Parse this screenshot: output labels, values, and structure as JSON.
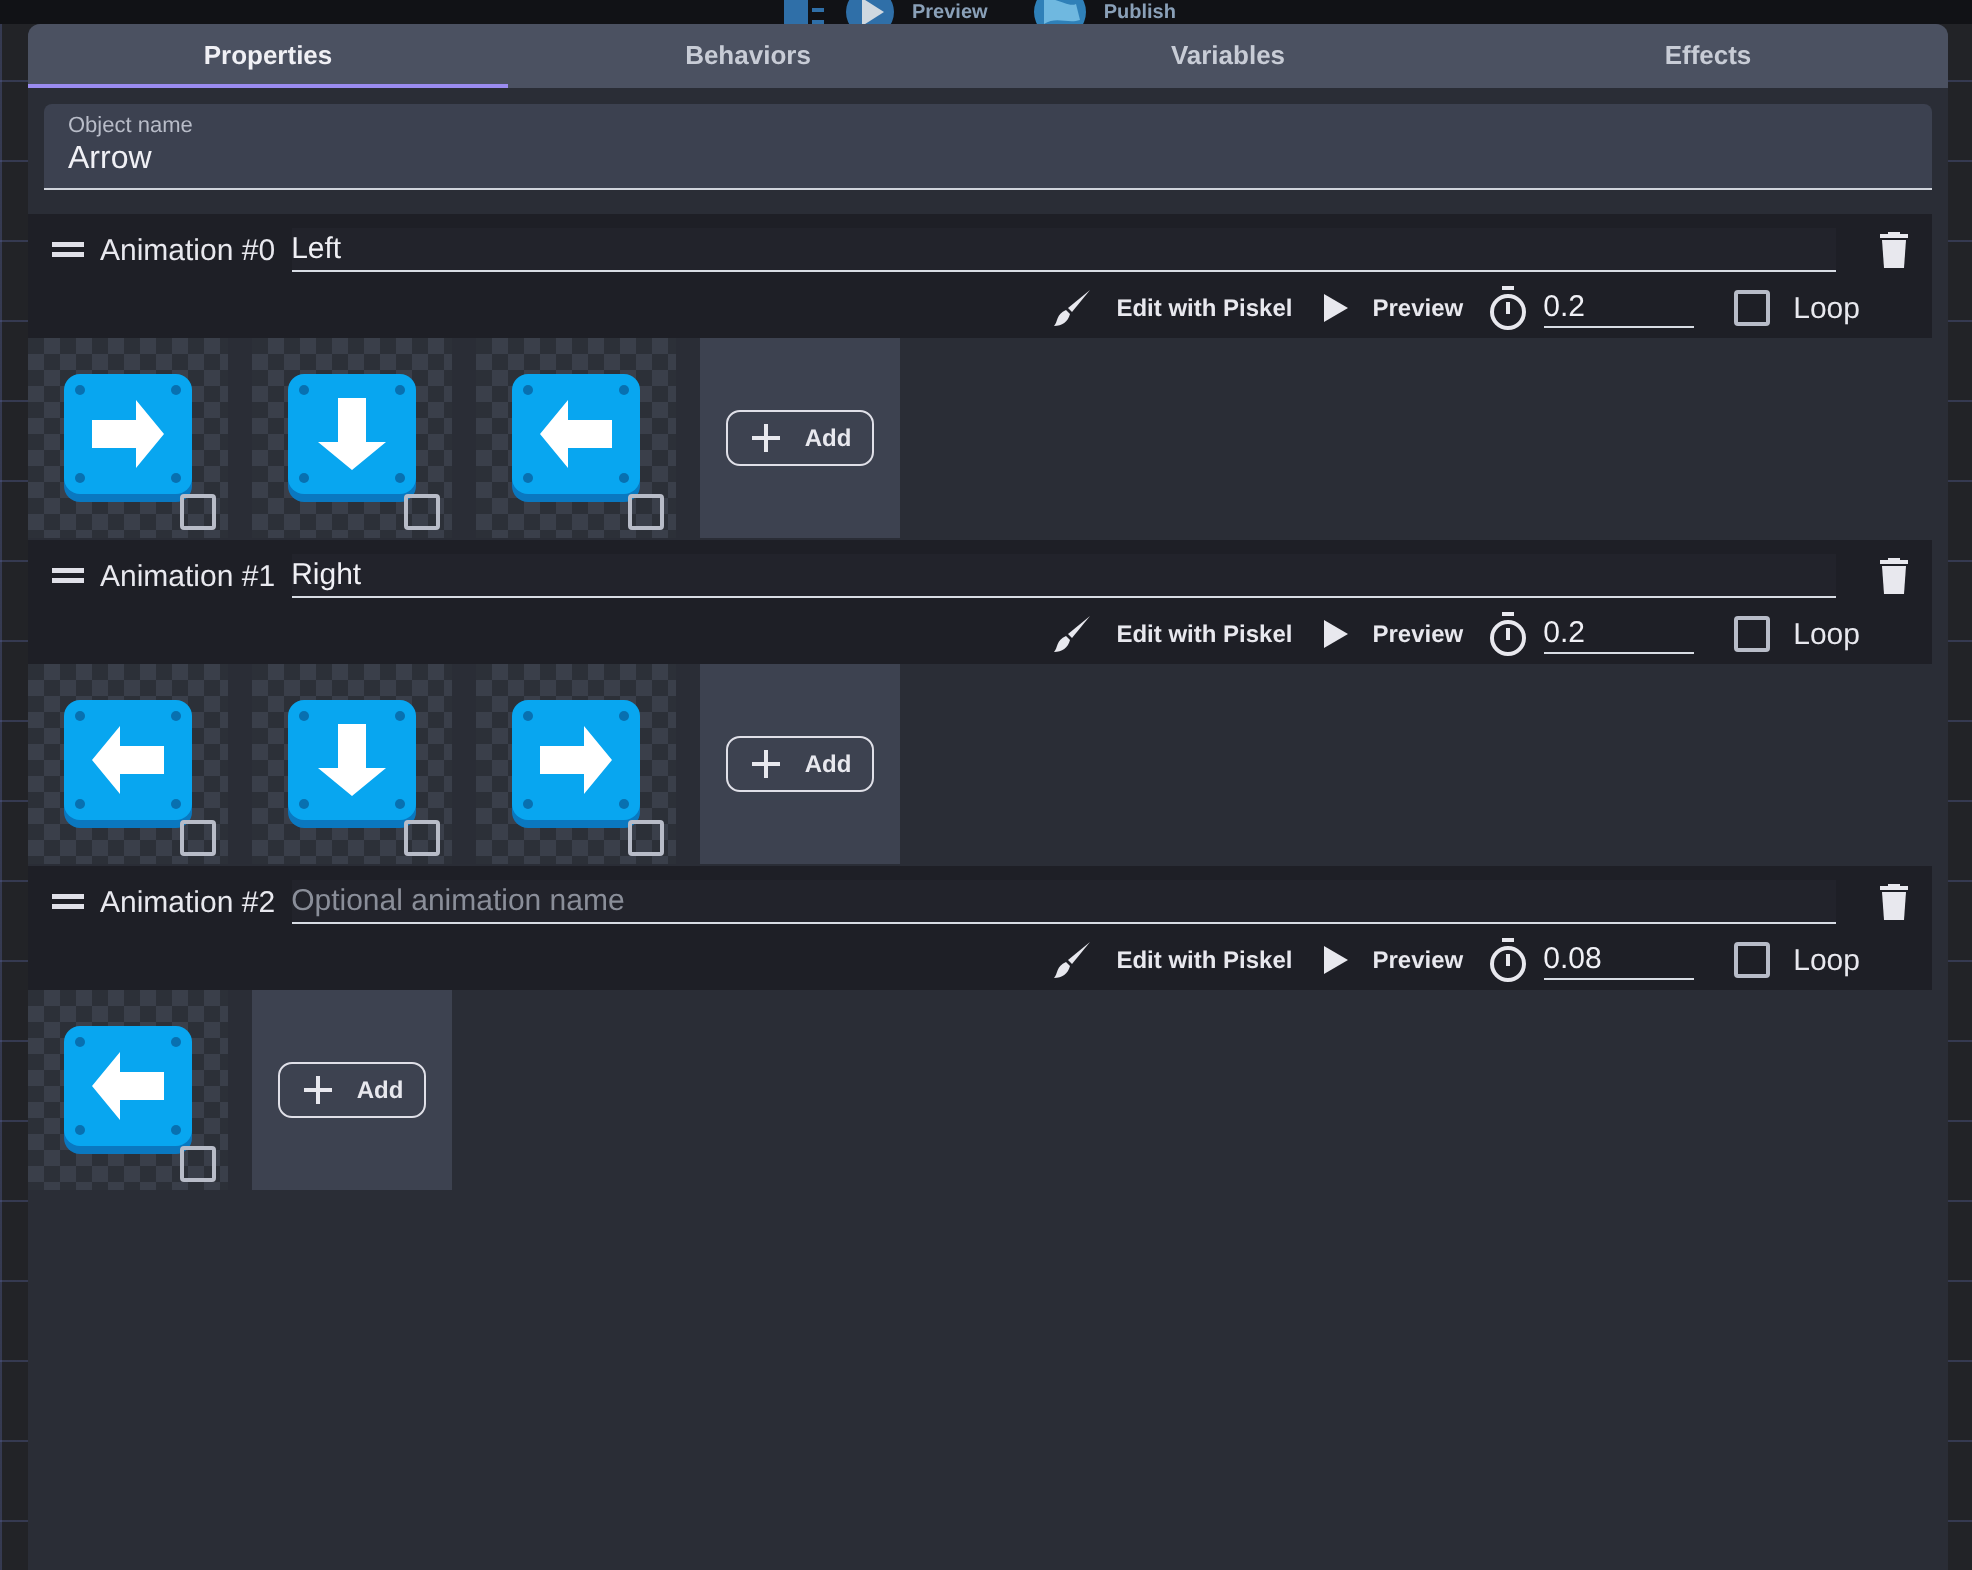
{
  "toolbar": {
    "items": [
      {
        "kind": "preview",
        "label": "Preview"
      },
      {
        "kind": "publish",
        "label": "Publish"
      }
    ]
  },
  "tabs": [
    {
      "label": "Properties",
      "selected": true
    },
    {
      "label": "Behaviors",
      "selected": false
    },
    {
      "label": "Variables",
      "selected": false
    },
    {
      "label": "Effects",
      "selected": false
    }
  ],
  "object_name": {
    "label": "Object name",
    "value": "Arrow"
  },
  "animations": [
    {
      "label": "Animation #0",
      "name": "Left",
      "edit_label": "Edit with Piskel",
      "preview_label": "Preview",
      "duration": "0.2",
      "loop": false,
      "loop_label": "Loop",
      "add_label": "Add",
      "frames": [
        {
          "kind": "right",
          "selected": false
        },
        {
          "kind": "down",
          "selected": false
        },
        {
          "kind": "left",
          "selected": false
        }
      ]
    },
    {
      "label": "Animation #1",
      "name": "Right",
      "edit_label": "Edit with Piskel",
      "preview_label": "Preview",
      "duration": "0.2",
      "loop": false,
      "loop_label": "Loop",
      "add_label": "Add",
      "frames": [
        {
          "kind": "left",
          "selected": false
        },
        {
          "kind": "down",
          "selected": false
        },
        {
          "kind": "right",
          "selected": false
        }
      ]
    },
    {
      "label": "Animation #2",
      "placeholder": "Optional animation name",
      "edit_label": "Edit with Piskel",
      "preview_label": "Preview",
      "duration": "0.08",
      "loop": false,
      "loop_label": "Loop",
      "add_label": "Add",
      "frames": [
        {
          "kind": "left",
          "selected": false
        }
      ]
    }
  ]
}
